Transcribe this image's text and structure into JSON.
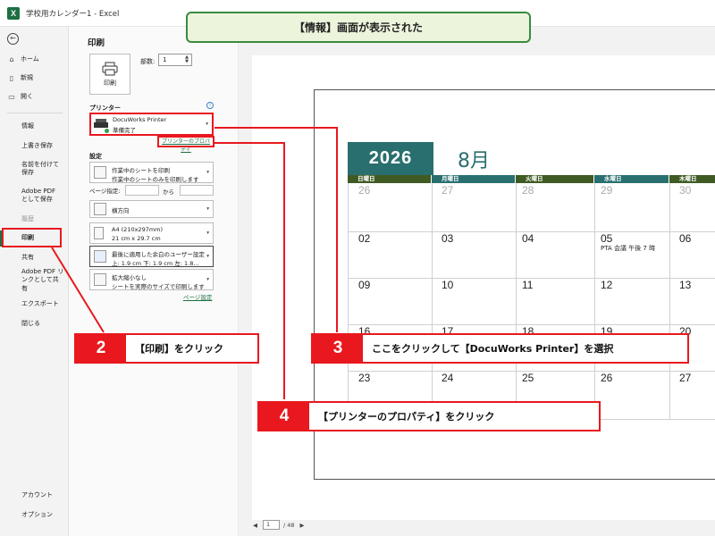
{
  "window": {
    "title": "学校用カレンダー1  -  Excel",
    "app_icon": "excel-icon"
  },
  "sidebar": {
    "items": [
      {
        "label": "ホーム",
        "icon": "home-icon"
      },
      {
        "label": "新規",
        "icon": "new-document-icon"
      },
      {
        "label": "開く",
        "icon": "folder-icon"
      },
      {
        "label": "情報"
      },
      {
        "label": "上書き保存"
      },
      {
        "label": "名前を付けて保存"
      },
      {
        "label": "Adobe PDF として保存"
      },
      {
        "label": "履歴"
      },
      {
        "label": "印刷"
      },
      {
        "label": "共有"
      },
      {
        "label": "Adobe PDF リンクとして共有"
      },
      {
        "label": "エクスポート"
      },
      {
        "label": "閉じる"
      }
    ],
    "bottom": [
      {
        "label": "アカウント"
      },
      {
        "label": "オプション"
      }
    ]
  },
  "panel": {
    "title": "印刷",
    "print_button": "印刷",
    "copies_label": "部数:",
    "copies_value": "1",
    "printer_section": "プリンター",
    "printer": {
      "name": "DocuWorks Printer",
      "status": "準備完了"
    },
    "printer_properties": "プリンターのプロパティ",
    "settings_section": "設定",
    "sheets": {
      "line1": "作業中のシートを印刷",
      "line2": "作業中のシートのみを印刷します"
    },
    "pages_label": "ページ指定:",
    "pages_to": "から",
    "orientation": "横方向",
    "paper": {
      "line1": "A4 (210x297mm)",
      "line2": "21 cm x 29.7 cm"
    },
    "margins": {
      "line1": "最後に適用した余白のユーザー設定",
      "line2": "上: 1.9 cm 下: 1.9 cm 左: 1.8..."
    },
    "scaling": {
      "line1": "拡大縮小なし",
      "line2": "シートを実際のサイズで印刷します"
    },
    "page_setup": "ページ設定"
  },
  "preview": {
    "current_page": "1",
    "total_pages": "/ 48",
    "calendar": {
      "year": "2026",
      "month": "8月",
      "days": [
        "日曜日",
        "月曜日",
        "火曜日",
        "水曜日",
        "木曜日"
      ],
      "rows": [
        [
          "26",
          "27",
          "28",
          "29",
          "30"
        ],
        [
          "02",
          "03",
          "04",
          "05",
          "06"
        ],
        [
          "09",
          "10",
          "11",
          "12",
          "13"
        ],
        [
          "16",
          "17",
          "18",
          "19",
          "20"
        ],
        [
          "23",
          "24",
          "25",
          "26",
          "27"
        ]
      ],
      "event": "PTA 会議 午後 7 時"
    }
  },
  "callouts": {
    "top": "【情報】画面が表示された",
    "step2": {
      "num": "2",
      "text": "【印刷】をクリック"
    },
    "step3": {
      "num": "3",
      "text": "ここをクリックして【DocuWorks Printer】を選択"
    },
    "step4": {
      "num": "4",
      "text": "【プリンターのプロパティ】をクリック"
    }
  },
  "colors": {
    "excel_green": "#1d6f42",
    "calendar_teal": "#2a6f6f",
    "header_green": "#3f5b23",
    "highlight_red": "#e8181e",
    "callout_green": "#3b8a3f"
  }
}
